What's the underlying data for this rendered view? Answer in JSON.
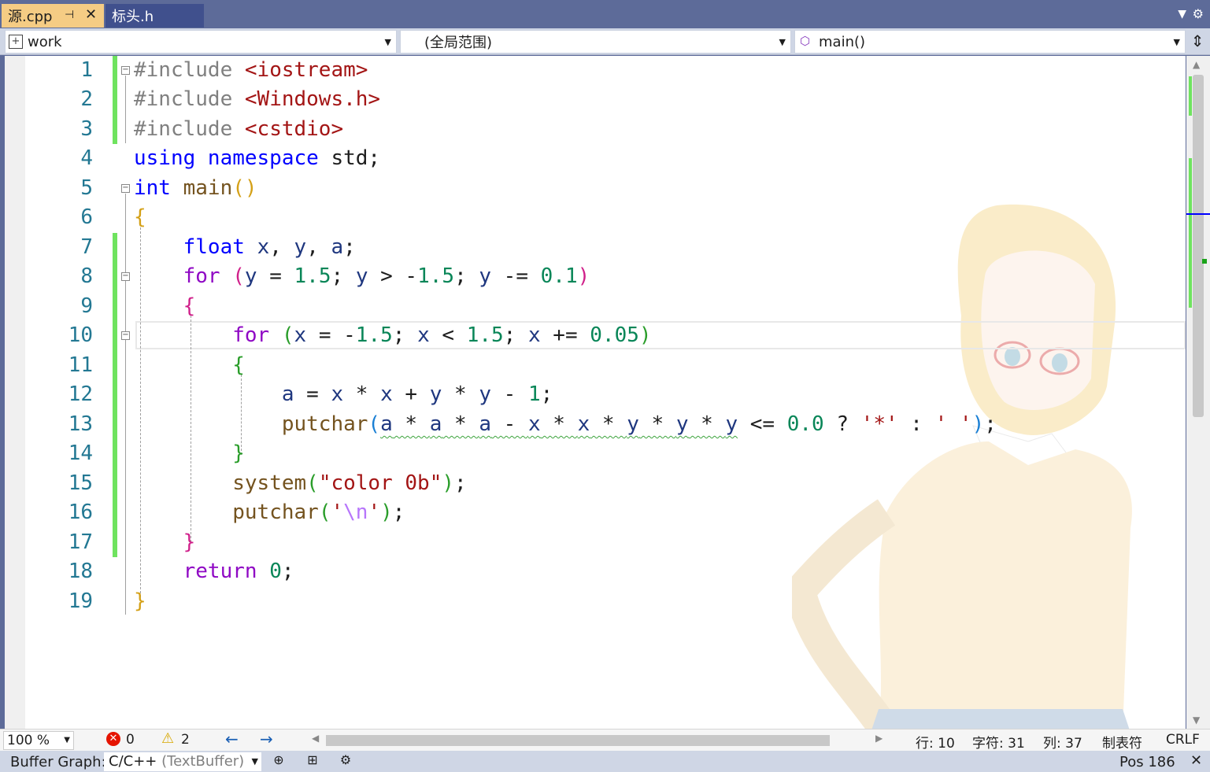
{
  "tabs": [
    {
      "label": "源.cpp",
      "active": true,
      "pinned": true
    },
    {
      "label": "标头.h",
      "active": false
    }
  ],
  "navbar": {
    "project": "work",
    "scope": "(全局范围)",
    "member": "main()"
  },
  "editor": {
    "line_numbers": [
      "1",
      "2",
      "3",
      "4",
      "5",
      "6",
      "7",
      "8",
      "9",
      "10",
      "11",
      "12",
      "13",
      "14",
      "15",
      "16",
      "17",
      "18",
      "19"
    ],
    "current_line": 10,
    "code_lines": [
      "#include <iostream>",
      "#include <Windows.h>",
      "#include <cstdio>",
      "using namespace std;",
      "int main()",
      "{",
      "    float x, y, a;",
      "    for (y = 1.5; y > -1.5; y -= 0.1)",
      "    {",
      "        for (x = -1.5; x < 1.5; x += 0.05)",
      "        {",
      "            a = x * x + y * y - 1;",
      "            putchar(a * a * a - x * x * y * y * y <= 0.0 ? '*' : ' ');",
      "        }",
      "        system(\"color 0b\");",
      "        putchar('\\n');",
      "    }",
      "    return 0;",
      "}"
    ]
  },
  "infobar": {
    "zoom": "100 %",
    "errors": "0",
    "warnings": "2",
    "line": "行: 10",
    "char": "字符: 31",
    "col": "列: 37",
    "tabs": "制表符",
    "eol": "CRLF"
  },
  "bufferbar": {
    "label": "Buffer Graph:",
    "content_type": "C/C++",
    "content_type_muted": "(TextBuffer)",
    "pos": "Pos  186"
  },
  "colors": {
    "keyword": "#0000ff",
    "control": "#8f08c4",
    "variable": "#1f377f",
    "number": "#098658",
    "function": "#74531f",
    "string": "#a31515",
    "line_number": "#237893",
    "changed_bar": "#6fe35f",
    "active_tab": "#f5cc84",
    "tab_bar": "#5d6b99"
  }
}
